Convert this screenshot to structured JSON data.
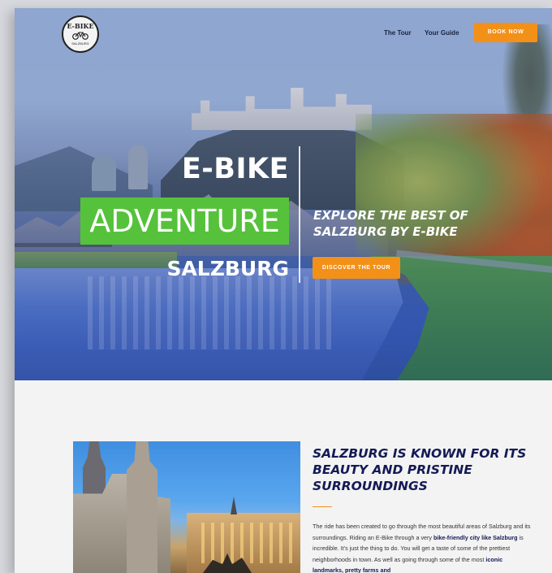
{
  "header": {
    "logo": {
      "title": "E-BIKE",
      "icon": "bicycle-icon",
      "subtitle": "SALZBURG"
    },
    "nav": [
      {
        "label": "The Tour"
      },
      {
        "label": "Your Guide"
      }
    ],
    "book_label": "BOOK NOW"
  },
  "hero": {
    "line1": "E-BIKE",
    "line2": "ADVENTURE",
    "line3": "SALZBURG",
    "tagline": "EXPLORE THE BEST OF SALZBURG BY E-BIKE",
    "cta_label": "DISCOVER THE TOUR"
  },
  "intro": {
    "title": "SALZBURG IS KNOWN FOR ITS BEAUTY AND PRISTINE SURROUNDINGS",
    "body": [
      {
        "text": "The ride has been created to go through the most beautiful areas of Salzburg and its surroundings. Riding an E-Bike through a very ",
        "bold": false
      },
      {
        "text": "bike-friendly city like Salzburg",
        "bold": true
      },
      {
        "text": " is incredible. It's just the thing to do. You will get a taste of some of the prettiest neighborhoods in town. As well as going through some of the most ",
        "bold": false
      },
      {
        "text": "iconic landmarks, pretty farms and",
        "bold": true
      }
    ]
  },
  "colors": {
    "accent_orange": "#f39018",
    "accent_green": "#56c13a",
    "heading_navy": "#141a55"
  }
}
